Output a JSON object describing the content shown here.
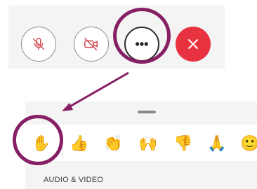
{
  "call_controls": {
    "mute_icon": "microphone-off-icon",
    "camera_icon": "camera-off-icon",
    "more_label": "•••",
    "leave_icon": "close-icon"
  },
  "reactions": {
    "items": [
      {
        "name": "raise-hand",
        "glyph": "✋"
      },
      {
        "name": "thumbs-up",
        "glyph": "👍"
      },
      {
        "name": "clap",
        "glyph": "👏"
      },
      {
        "name": "celebrate",
        "glyph": "🙌"
      },
      {
        "name": "thumbs-down",
        "glyph": "👎"
      },
      {
        "name": "pray",
        "glyph": "🙏"
      },
      {
        "name": "smile",
        "glyph": "🙂"
      }
    ]
  },
  "section": {
    "audio_video_label": "AUDIO & VIDEO"
  },
  "colors": {
    "highlight": "#861f63",
    "leave": "#e8323f",
    "mute_icon": "#d3474f"
  }
}
